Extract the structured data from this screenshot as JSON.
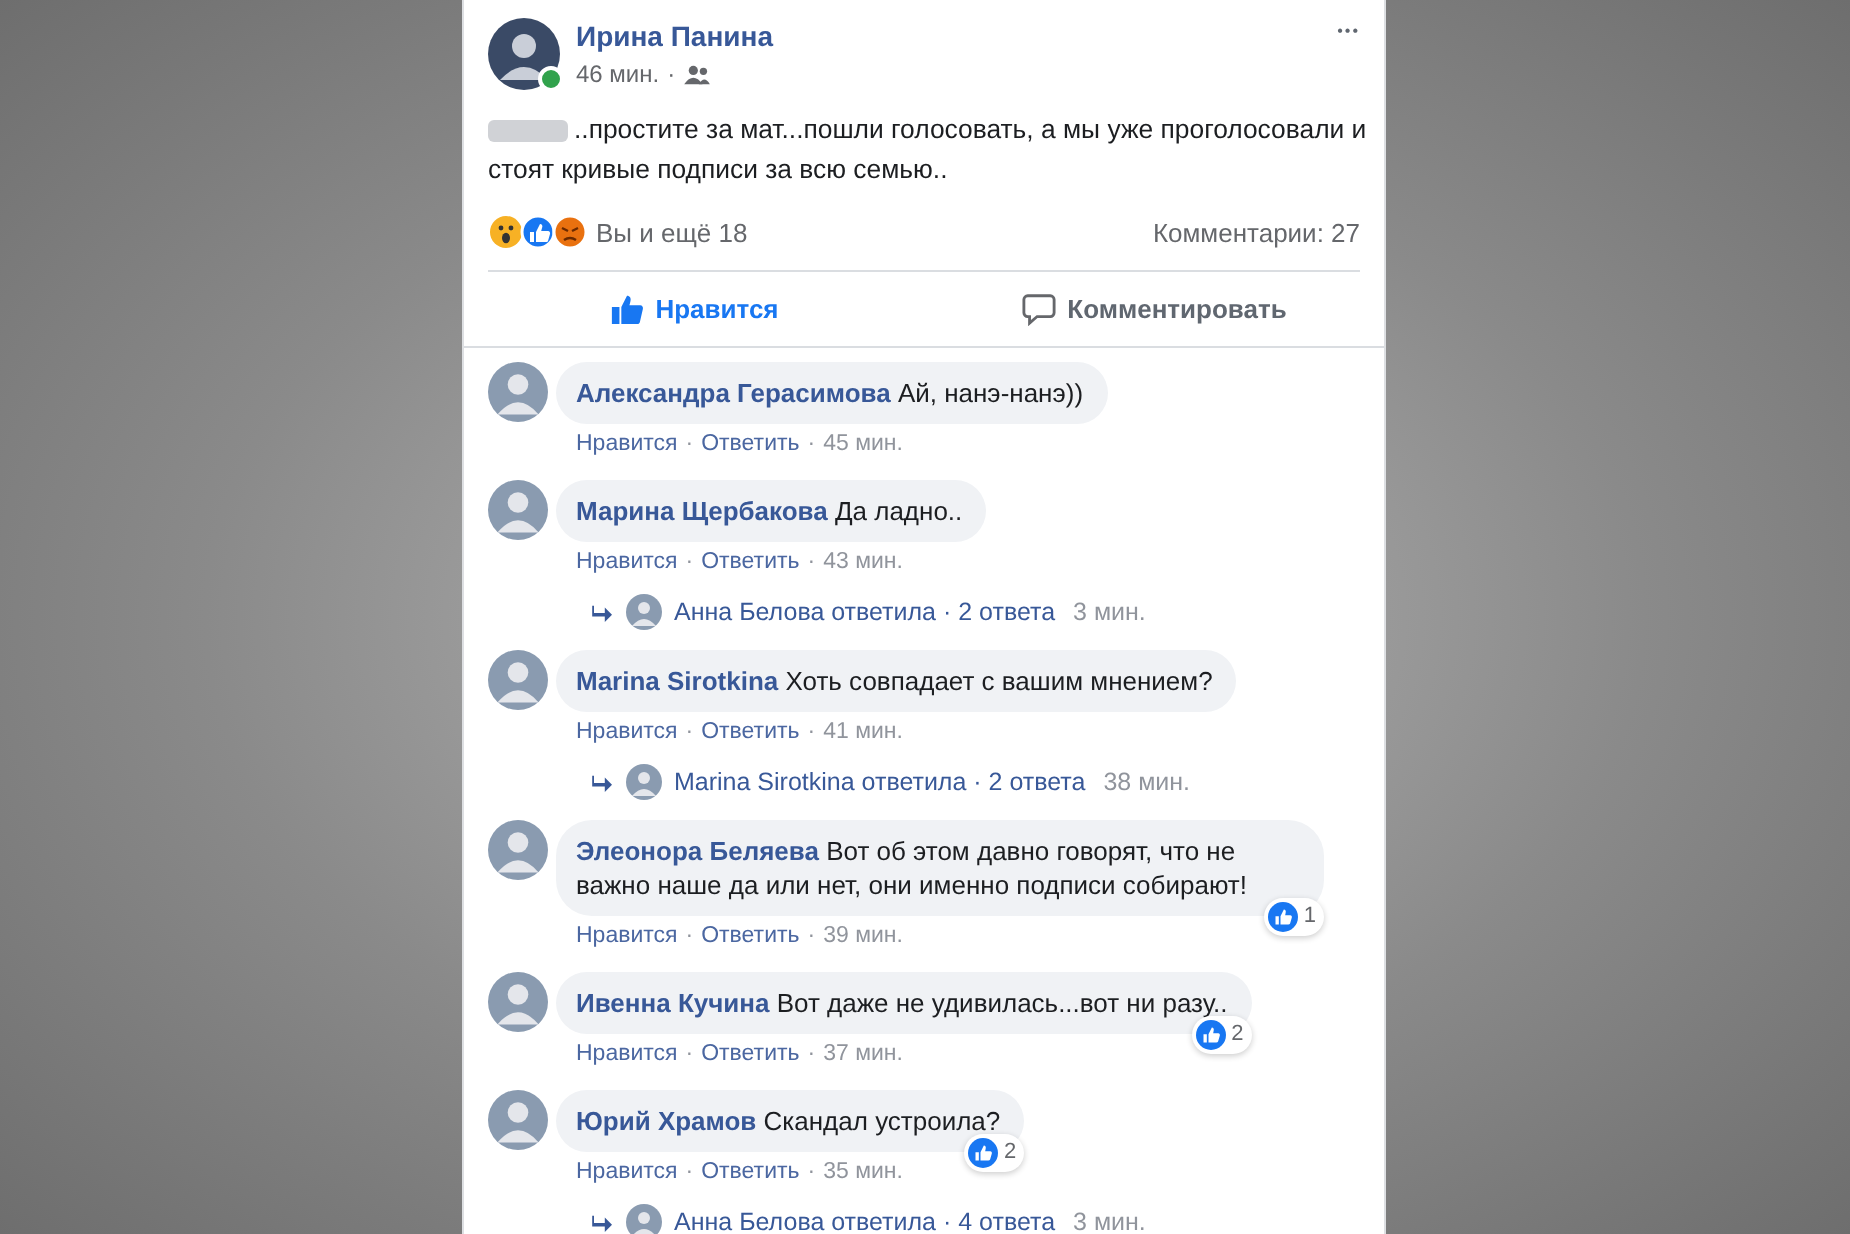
{
  "post": {
    "author": "Ирина Панина",
    "online": true,
    "time": "46 мин.",
    "separator": "·",
    "text_lines": [
      "..простите за мат...пошли голосовать, а мы уже проголосовали и",
      "стоят кривые подписи за всю семью.."
    ],
    "reactions_text": "Вы и ещё 18",
    "comments_count": "Комментарии: 27",
    "more": "•••",
    "actions": [
      {
        "kind": "like",
        "label": "Нравится",
        "on": true
      },
      {
        "kind": "comment",
        "label": "Комментировать",
        "on": false
      }
    ]
  },
  "comments": [
    {
      "name": "Александра Герасимова",
      "text": "Ай, нанэ-нанэ))",
      "like": "Нравится",
      "reply": "Ответить",
      "time": "45 мин."
    },
    {
      "name": "Марина Щербакова",
      "text": "Да ладно..",
      "like": "Нравится",
      "reply": "Ответить",
      "time": "43 мин.",
      "replies": {
        "text": "Анна Белова ответила · 2 ответа",
        "time": "3 мин."
      }
    },
    {
      "name": "Marina Sirotkina",
      "text": "Хоть совпадает с вашим мнением?",
      "like": "Нравится",
      "reply": "Ответить",
      "time": "41 мин.",
      "replies": {
        "text": "Marina Sirotkina ответила · 2 ответа",
        "time": "38 мин."
      }
    },
    {
      "name": "Элеонора Беляева",
      "text": "Вот об этом давно говорят, что не важно наше да или нет, они именно подписи собирают!",
      "like": "Нравится",
      "reply": "Ответить",
      "time": "39 мин.",
      "likes": "1"
    },
    {
      "name": "Ивенна Кучина",
      "text": "Вот даже не удивилась...вот ни разу..",
      "like": "Нравится",
      "reply": "Ответить",
      "time": "37 мин.",
      "likes": "2"
    },
    {
      "name": "Юрий Храмов",
      "text": "Скандал устроила?",
      "like": "Нравится",
      "reply": "Ответить",
      "time": "35 мин.",
      "likes": "2",
      "replies": {
        "text": "Анна Белова ответила · 4 ответа",
        "time": "3 мин."
      }
    }
  ]
}
